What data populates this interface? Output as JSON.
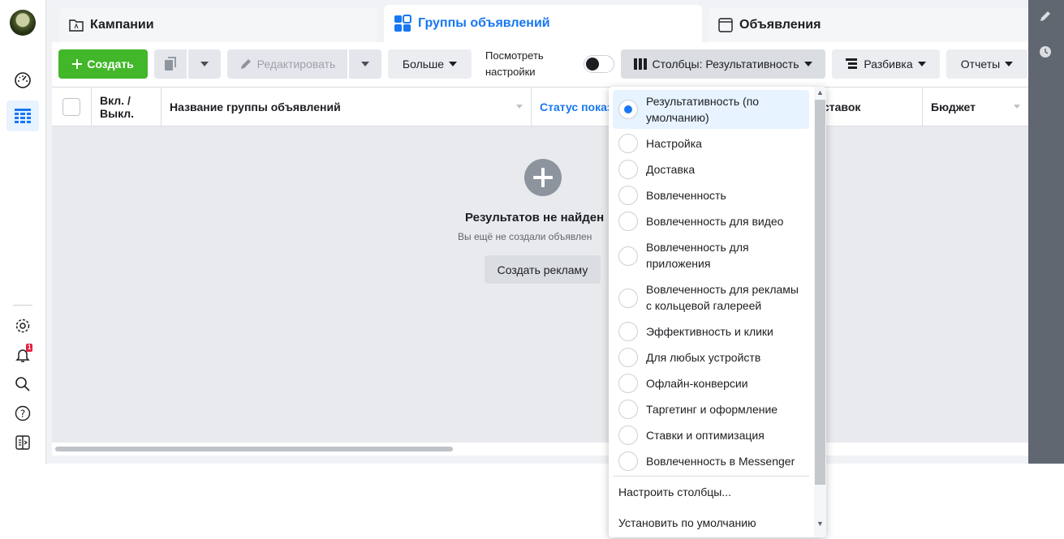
{
  "tabs": [
    {
      "label": "Кампании",
      "icon": "folder-icon"
    },
    {
      "label": "Группы объявлений",
      "icon": "grid-icon"
    },
    {
      "label": "Объявления",
      "icon": "ad-icon"
    }
  ],
  "toolbar": {
    "create": "Создать",
    "edit": "Редактировать",
    "more": "Больше",
    "view_settings_line1": "Посмотреть",
    "view_settings_line2": "настройки",
    "columns": "Столбцы: Результативность",
    "breakdown": "Разбивка",
    "reports": "Отчеты"
  },
  "table": {
    "col_onoff_1": "Вкл. /",
    "col_onoff_2": "Выкл.",
    "col_name": "Название группы объявлений",
    "col_status": "Статус показ",
    "col_bid": "ставок",
    "col_budget": "Бюджет"
  },
  "empty": {
    "title": "Результатов не найден",
    "subtitle": "Вы ещё не создали объявлен",
    "button": "Создать рекламу"
  },
  "dropdown": {
    "options": [
      {
        "label_line1": "Результативность (по",
        "label_line2": "умолчанию)",
        "selected": true
      },
      {
        "label_line1": "Настройка",
        "label_line2": ""
      },
      {
        "label_line1": "Доставка",
        "label_line2": ""
      },
      {
        "label_line1": "Вовлеченность",
        "label_line2": ""
      },
      {
        "label_line1": "Вовлеченность для видео",
        "label_line2": ""
      },
      {
        "label_line1": "Вовлеченность для",
        "label_line2": "приложения"
      },
      {
        "label_line1": "Вовлеченность для рекламы",
        "label_line2": "с кольцевой галереей"
      },
      {
        "label_line1": "Эффективность и клики",
        "label_line2": ""
      },
      {
        "label_line1": "Для любых устройств",
        "label_line2": ""
      },
      {
        "label_line1": "Офлайн-конверсии",
        "label_line2": ""
      },
      {
        "label_line1": "Таргетинг и оформление",
        "label_line2": ""
      },
      {
        "label_line1": "Ставки и оптимизация",
        "label_line2": ""
      },
      {
        "label_line1": "Вовлеченность в Messenger",
        "label_line2": ""
      }
    ],
    "customize": "Настроить столбцы...",
    "set_default": "Установить по умолчанию"
  },
  "notifications_count": "1",
  "colors": {
    "accent": "#1877f2",
    "green": "#42b72a",
    "badge": "#e41e3f"
  }
}
